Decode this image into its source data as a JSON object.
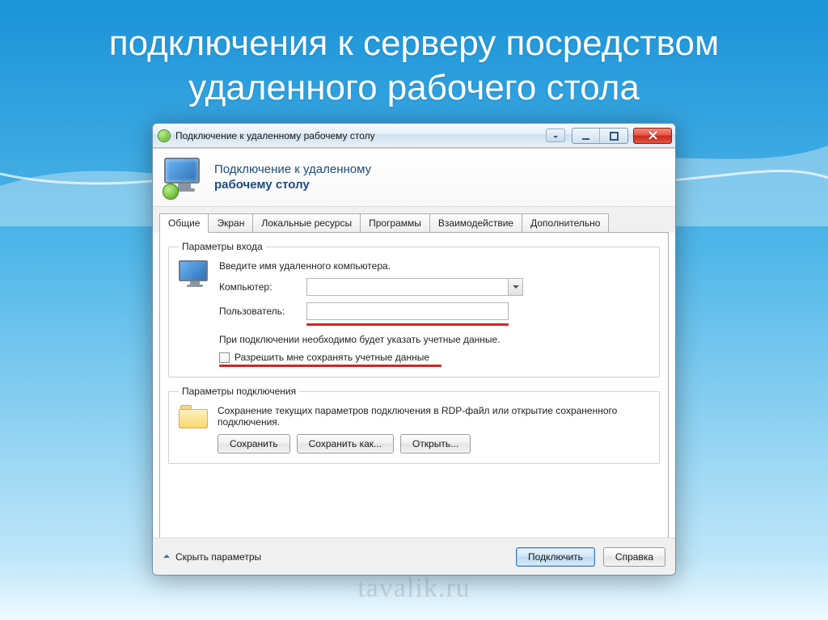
{
  "slide": {
    "title": "подключения к серверу посредством удаленного рабочего стола"
  },
  "window": {
    "title": "Подключение к удаленному рабочему столу",
    "header_line1": "Подключение к удаленному",
    "header_line2": "рабочему столу"
  },
  "tabs": [
    "Общие",
    "Экран",
    "Локальные ресурсы",
    "Программы",
    "Взаимодействие",
    "Дополнительно"
  ],
  "login": {
    "legend": "Параметры входа",
    "intro": "Введите имя удаленного компьютера.",
    "computer_label": "Компьютер:",
    "computer_value": "",
    "user_label": "Пользователь:",
    "user_value": "",
    "hint": "При подключении необходимо будет указать учетные данные.",
    "save_creds": "Разрешить мне сохранять учетные данные"
  },
  "params": {
    "legend": "Параметры подключения",
    "desc": "Сохранение текущих параметров подключения в RDP-файл или открытие сохраненного подключения.",
    "save": "Сохранить",
    "save_as": "Сохранить как...",
    "open": "Открыть..."
  },
  "footer": {
    "hide": "Скрыть параметры",
    "connect": "Подключить",
    "help": "Справка"
  },
  "watermark": "tavalik.ru"
}
